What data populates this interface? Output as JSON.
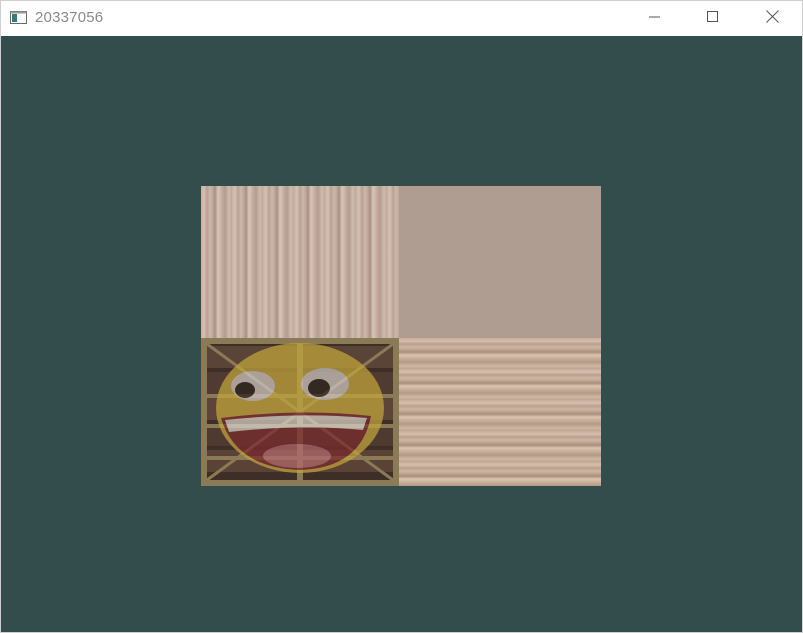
{
  "window": {
    "title": "20337056",
    "icon": "app-window-icon",
    "controls": {
      "minimize_icon": "minimize-icon",
      "maximize_icon": "maximize-icon",
      "close_icon": "close-icon"
    }
  },
  "scene": {
    "clear_color": "#334c4c",
    "textures": [
      "wooden-crate-texture",
      "awesome-face-texture"
    ]
  }
}
